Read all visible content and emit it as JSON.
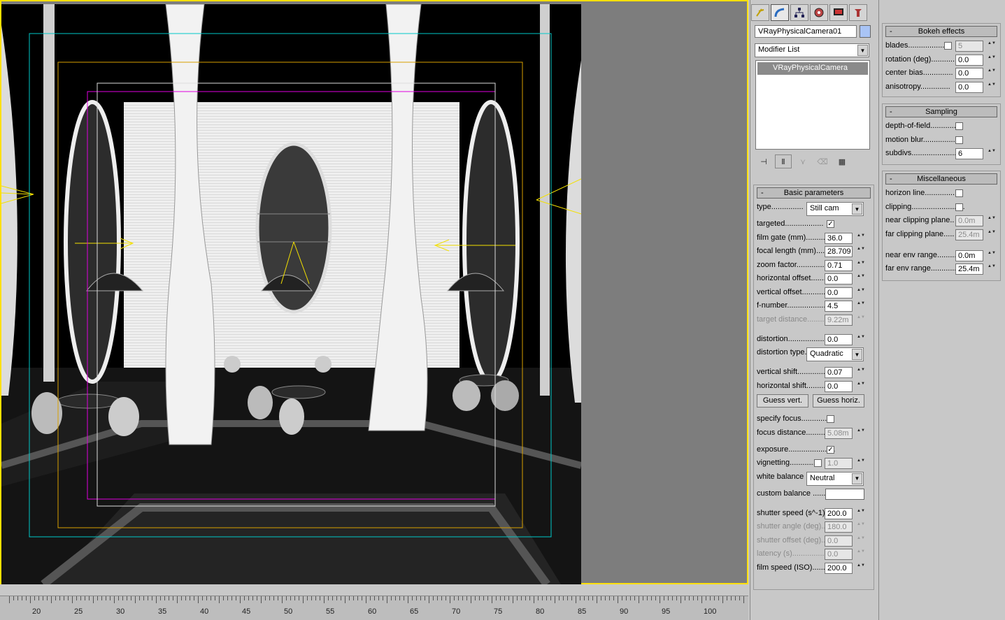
{
  "command_panel": {
    "tabs": [
      "create-icon",
      "modify-icon",
      "hierarchy-icon",
      "motion-icon",
      "display-icon",
      "utilities-icon"
    ],
    "object_name": "VRayPhysicalCamera01",
    "object_color": "#a9c4f5",
    "modifier_list_label": "Modifier List",
    "stack_item": "VRayPhysicalCamera"
  },
  "basic_parameters": {
    "title": "Basic parameters",
    "type_label": "type...............",
    "type_value": "Still cam",
    "targeted_label": "targeted..................",
    "film_gate_label": "film gate (mm)...........",
    "film_gate_value": "36.0",
    "focal_length_label": "focal length (mm).......",
    "focal_length_value": "28.709",
    "zoom_factor_label": "zoom factor..............",
    "zoom_factor_value": "0.71",
    "horizontal_offset_label": "horizontal offset.........",
    "horizontal_offset_value": "0.0",
    "vertical_offset_label": "vertical offset............",
    "vertical_offset_value": "0.0",
    "f_number_label": "f-number.....................",
    "f_number_value": "4.5",
    "target_distance_label": "target distance...........",
    "target_distance_value": "9.22m",
    "distortion_label": "distortion....................",
    "distortion_value": "0.0",
    "distortion_type_label": "distortion type.",
    "distortion_type_value": "Quadratic",
    "vertical_shift_label": "vertical shift..............",
    "vertical_shift_value": "0.07",
    "horizontal_shift_label": "horizontal shift...........",
    "horizontal_shift_value": "0.0",
    "guess_vert_label": "Guess vert.",
    "guess_horiz_label": "Guess horiz.",
    "specify_focus_label": "specify focus..............",
    "focus_distance_label": "focus distance...........",
    "focus_distance_value": "5.08m",
    "exposure_label": "exposure......................",
    "vignetting_label": "vignetting...............",
    "vignetting_value": "1.0",
    "white_balance_label": "white balance",
    "white_balance_value": "Neutral",
    "custom_balance_label": "custom balance .......",
    "shutter_speed_label": "shutter speed (s^-1).",
    "shutter_speed_value": "200.0",
    "shutter_angle_label": "shutter angle (deg)...",
    "shutter_angle_value": "180.0",
    "shutter_offset_label": "shutter offset (deg)...",
    "shutter_offset_value": "0.0",
    "latency_label": "latency (s)..................",
    "latency_value": "0.0",
    "film_speed_label": "film speed (ISO)..........",
    "film_speed_value": "200.0"
  },
  "bokeh": {
    "title": "Bokeh effects",
    "blades_label": "blades..................",
    "blades_value": "5",
    "rotation_label": "rotation (deg)...........",
    "rotation_value": "0.0",
    "center_bias_label": "center bias..............",
    "center_bias_value": "0.0",
    "anisotropy_label": "anisotropy..............",
    "anisotropy_value": "0.0"
  },
  "sampling": {
    "title": "Sampling",
    "dof_label": "depth-of-field..............",
    "motion_blur_label": "motion blur...................",
    "subdivs_label": "subdivs...........................",
    "subdivs_value": "6"
  },
  "misc": {
    "title": "Miscellaneous",
    "horizon_label": "horizon line.................",
    "clipping_label": "clipping.........................",
    "near_clip_label": "near clipping plane..",
    "near_clip_value": "0.0m",
    "far_clip_label": "far clipping plane.....",
    "far_clip_value": "25.4m",
    "near_env_label": "near env range.........",
    "near_env_value": "0.0m",
    "far_env_label": "far env range............",
    "far_env_value": "25.4m"
  },
  "timeline": {
    "labels": [
      "20",
      "25",
      "30",
      "35",
      "40",
      "45",
      "50",
      "55",
      "60",
      "65",
      "70",
      "75",
      "80",
      "85",
      "90",
      "95",
      "100"
    ]
  }
}
